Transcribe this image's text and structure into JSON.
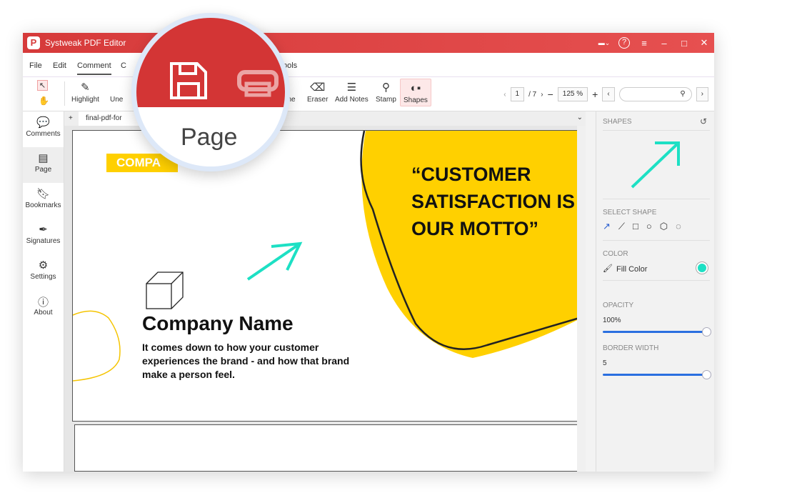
{
  "app": {
    "title": "Systweak PDF Editor",
    "logo": "P"
  },
  "window_controls": {
    "flag": "us-flag-icon",
    "help": "?",
    "menu": "≡",
    "minimize": "–",
    "maximize": "□",
    "close": "✕"
  },
  "menu": [
    "File",
    "Edit",
    "Comment",
    "C",
    "ools"
  ],
  "toolbar": {
    "tools": [
      {
        "label": "Highlight",
        "icon": "pen-icon"
      },
      {
        "label": "Une",
        "icon": ""
      },
      {
        "label": "line",
        "icon": ""
      },
      {
        "label": "Eraser",
        "icon": "eraser-icon"
      },
      {
        "label": "Add Notes",
        "icon": "note-icon"
      },
      {
        "label": "Stamp",
        "icon": "stamp-icon"
      },
      {
        "label": "Shapes",
        "icon": "shapes-icon"
      }
    ],
    "page_current": "1",
    "page_total": "/ 7",
    "zoom": "125 %",
    "search_placeholder": ""
  },
  "sidebar": {
    "items": [
      {
        "label": "Comments"
      },
      {
        "label": "Page"
      },
      {
        "label": "Bookmarks"
      },
      {
        "label": "Signatures"
      },
      {
        "label": "Settings"
      },
      {
        "label": "About"
      }
    ]
  },
  "tab": {
    "plus": "+",
    "name": "final-pdf-for"
  },
  "document": {
    "badge": "COMPA",
    "quote": "“CUSTOMER SATISFACTION IS OUR MOTTO”",
    "company": "Company Name",
    "tagline": "It comes down to how your customer experiences the brand - and how that brand make a person feel."
  },
  "magnifier": {
    "label": "Page"
  },
  "panel": {
    "title": "SHAPES",
    "select_shape": "SELECT SHAPE",
    "color_heading": "COLOR",
    "fill_color": "Fill Color",
    "fill_hex": "#1de0c4",
    "opacity_heading": "OPACITY",
    "opacity": "100%",
    "opacity_value": 100,
    "border_heading": "BORDER WIDTH",
    "border_width": "5",
    "border_value": 100,
    "shapes": [
      "arrow",
      "line",
      "rectangle",
      "circle",
      "hexagon",
      "arc"
    ],
    "selected_shape": "arrow"
  },
  "colors": {
    "brand": "#d63a3a",
    "accent": "#1de0c4",
    "yellow": "#ffd000"
  }
}
